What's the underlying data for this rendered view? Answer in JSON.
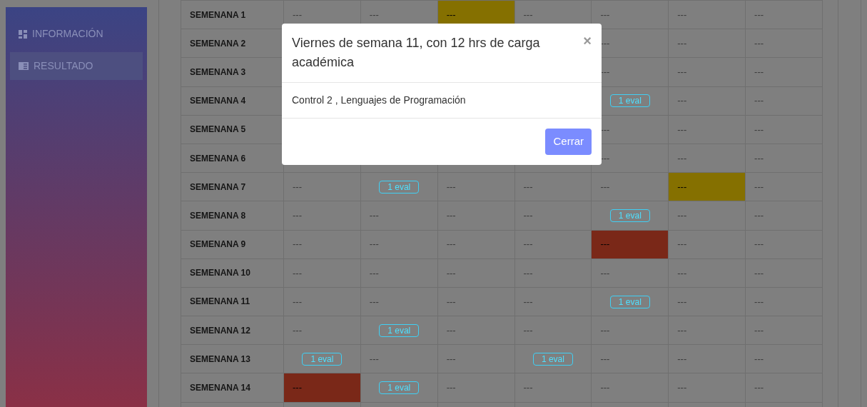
{
  "sidebar": {
    "items": [
      {
        "label": "INFORMACIÓN",
        "selected": false
      },
      {
        "label": "RESULTADO",
        "selected": true
      }
    ]
  },
  "table": {
    "rows": [
      {
        "label": "SEMENANA 1",
        "cells": [
          {
            "kind": "dash",
            "text": "---"
          },
          {
            "kind": "dash",
            "text": "---"
          },
          {
            "kind": "dash",
            "text": "---",
            "color": "#857000"
          },
          {
            "kind": "dash",
            "text": "---"
          },
          {
            "kind": "dash",
            "text": "---"
          },
          {
            "kind": "dash",
            "text": "---"
          },
          {
            "kind": "dash",
            "text": "---"
          }
        ]
      },
      {
        "label": "SEMENANA 2",
        "cells": [
          null,
          null,
          null,
          null,
          {
            "kind": "dash",
            "text": "---"
          },
          {
            "kind": "dash",
            "text": "---"
          },
          {
            "kind": "dash",
            "text": "---"
          }
        ]
      },
      {
        "label": "SEMENANA 3",
        "cells": [
          null,
          null,
          null,
          null,
          {
            "kind": "dash",
            "text": "---"
          },
          {
            "kind": "dash",
            "text": "---"
          },
          {
            "kind": "dash",
            "text": "---"
          }
        ]
      },
      {
        "label": "SEMENANA 4",
        "cells": [
          null,
          null,
          null,
          null,
          {
            "kind": "badge",
            "text": "1 eval"
          },
          {
            "kind": "dash",
            "text": "---"
          },
          {
            "kind": "dash",
            "text": "---"
          }
        ]
      },
      {
        "label": "SEMENANA 5",
        "cells": [
          null,
          null,
          null,
          null,
          {
            "kind": "dash",
            "text": "---"
          },
          {
            "kind": "dash",
            "text": "---"
          },
          {
            "kind": "dash",
            "text": "---"
          }
        ]
      },
      {
        "label": "SEMENANA 6",
        "cells": [
          null,
          null,
          null,
          null,
          {
            "kind": "dash",
            "text": "---"
          },
          {
            "kind": "dash",
            "text": "---"
          },
          {
            "kind": "dash",
            "text": "---"
          }
        ]
      },
      {
        "label": "SEMENANA 7",
        "cells": [
          {
            "kind": "dash",
            "text": "---"
          },
          {
            "kind": "badge",
            "text": "1 eval"
          },
          {
            "kind": "dash",
            "text": "---"
          },
          {
            "kind": "dash",
            "text": "---"
          },
          {
            "kind": "dash",
            "text": "---"
          },
          {
            "kind": "dash",
            "text": "---",
            "color": "#857000"
          },
          {
            "kind": "dash",
            "text": "---"
          }
        ]
      },
      {
        "label": "SEMENANA 8",
        "cells": [
          {
            "kind": "dash",
            "text": "---"
          },
          {
            "kind": "dash",
            "text": "---"
          },
          {
            "kind": "dash",
            "text": "---"
          },
          {
            "kind": "dash",
            "text": "---"
          },
          {
            "kind": "badge",
            "text": "1 eval"
          },
          {
            "kind": "dash",
            "text": "---"
          },
          {
            "kind": "dash",
            "text": "---"
          }
        ]
      },
      {
        "label": "SEMENANA 9",
        "cells": [
          {
            "kind": "dash",
            "text": "---"
          },
          {
            "kind": "dash",
            "text": "---"
          },
          {
            "kind": "dash",
            "text": "---"
          },
          {
            "kind": "dash",
            "text": "---"
          },
          {
            "kind": "dash",
            "text": "---",
            "color": "#7a2818"
          },
          {
            "kind": "dash",
            "text": "---"
          },
          {
            "kind": "dash",
            "text": "---"
          }
        ]
      },
      {
        "label": "SEMENANA 10",
        "cells": [
          {
            "kind": "dash",
            "text": "---"
          },
          {
            "kind": "dash",
            "text": "---"
          },
          {
            "kind": "dash",
            "text": "---"
          },
          {
            "kind": "dash",
            "text": "---"
          },
          {
            "kind": "dash",
            "text": "---"
          },
          {
            "kind": "dash",
            "text": "---"
          },
          {
            "kind": "dash",
            "text": "---"
          }
        ]
      },
      {
        "label": "SEMENANA 11",
        "cells": [
          {
            "kind": "dash",
            "text": "---"
          },
          {
            "kind": "dash",
            "text": "---"
          },
          {
            "kind": "dash",
            "text": "---"
          },
          {
            "kind": "dash",
            "text": "---"
          },
          {
            "kind": "badge",
            "text": "1 eval"
          },
          {
            "kind": "dash",
            "text": "---"
          },
          {
            "kind": "dash",
            "text": "---"
          }
        ]
      },
      {
        "label": "SEMENANA 12",
        "cells": [
          {
            "kind": "dash",
            "text": "---"
          },
          {
            "kind": "badge",
            "text": "1 eval"
          },
          {
            "kind": "dash",
            "text": "---"
          },
          {
            "kind": "dash",
            "text": "---"
          },
          {
            "kind": "dash",
            "text": "---"
          },
          {
            "kind": "dash",
            "text": "---"
          },
          {
            "kind": "dash",
            "text": "---"
          }
        ]
      },
      {
        "label": "SEMENANA 13",
        "cells": [
          {
            "kind": "badge",
            "text": "1 eval"
          },
          {
            "kind": "dash",
            "text": "---"
          },
          {
            "kind": "dash",
            "text": "---"
          },
          {
            "kind": "badge",
            "text": "1 eval"
          },
          {
            "kind": "dash",
            "text": "---"
          },
          {
            "kind": "dash",
            "text": "---"
          },
          {
            "kind": "dash",
            "text": "---"
          }
        ]
      },
      {
        "label": "SEMENANA 14",
        "cells": [
          {
            "kind": "dash",
            "text": "---",
            "color": "#7a2818"
          },
          {
            "kind": "badge",
            "text": "1 eval"
          },
          {
            "kind": "dash",
            "text": "---"
          },
          {
            "kind": "dash",
            "text": "---"
          },
          {
            "kind": "dash",
            "text": "---"
          },
          {
            "kind": "dash",
            "text": "---"
          },
          {
            "kind": "dash",
            "text": "---"
          }
        ]
      }
    ]
  },
  "modal": {
    "title": "Viernes de semana 11, con 12 hrs de carga académica",
    "close": "×",
    "body": "Control 2 , Lenguajes de Programación",
    "button": "Cerrar"
  }
}
